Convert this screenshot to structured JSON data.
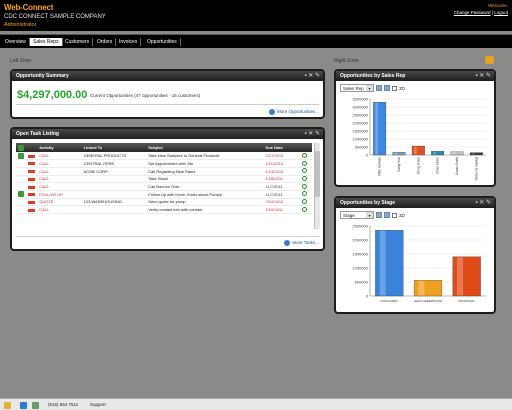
{
  "header": {
    "logo": "Web-Connect",
    "company": "CDC CONNECT SAMPLE COMPANY",
    "role": "Administrator",
    "welcome": "Welcome,",
    "change_password": "Change Password",
    "separator": "|",
    "logout": "Logout"
  },
  "nav": {
    "items": [
      "Overview",
      "Sales Reps",
      "Customers",
      "Orders",
      "Invoices",
      "Opportunities"
    ]
  },
  "left_zone_label": "Left Zone",
  "right_zone_label": "Right Zone",
  "opp_summary": {
    "title": "Opportunity Summary",
    "amount": "$4,297,000.00",
    "desc": "Current Opportunities (47 opportunities - 16 customers)",
    "more": "More Opportunities..."
  },
  "tasks": {
    "title": "Open Task Listing",
    "columns": [
      "Activity",
      "Linked To",
      "Subject",
      "Due Date"
    ],
    "rows": [
      {
        "flag": "done",
        "activity": "CALL",
        "linked": "GENERAL PRODUCTS",
        "subject": "Take New Samples to General Products",
        "due": "2/27/2013",
        "late": true
      },
      {
        "flag": "",
        "activity": "CALL",
        "linked": "CENTRAL PERK",
        "subject": "Set Appointment with Jim",
        "due": "1/11/2013",
        "late": true
      },
      {
        "flag": "",
        "activity": "CALL",
        "linked": "ACME CORP",
        "subject": "Call Regarding New Rates",
        "due": "1/13/2013",
        "late": true
      },
      {
        "flag": "",
        "activity": "CALL",
        "linked": "",
        "subject": "Take Stock",
        "due": "1/28/2011",
        "late": true
      },
      {
        "flag": "",
        "activity": "CALL",
        "linked": "",
        "subject": "Call Bounce Over",
        "due": "11/7/2011",
        "late": false
      },
      {
        "flag": "done",
        "activity": "FOLLOW UP",
        "linked": "",
        "subject": "Follow Up with Kevin Jones about Pumps",
        "due": "11/7/2011",
        "late": false
      },
      {
        "flag": "",
        "activity": "QUOTE",
        "linked": "123 WAREHOUSING",
        "subject": "Send quote for pump",
        "due": "7/19/2012",
        "late": true
      },
      {
        "flag": "",
        "activity": "CALL",
        "linked": "",
        "subject": "Verify contact info with contact",
        "due": "1/19/2011",
        "late": true
      }
    ],
    "more": "More Tasks..."
  },
  "sales_rep_panel": {
    "title": "Opportunities by Sales Rep",
    "select": "Sales Rep",
    "toggle_label": "3D"
  },
  "stage_panel": {
    "title": "Opportunities by Stage",
    "select": "Stage",
    "toggle_label": "3D"
  },
  "chart_data": [
    {
      "type": "bar",
      "title": "Opportunities by Sales Rep",
      "categories": [
        "Mike Hannah",
        "Kathy Kiwi",
        "Doug Jones",
        "Chad Stone",
        "Susan Smith",
        "Rebecca Hadley"
      ],
      "values": [
        3300000,
        180000,
        560000,
        230000,
        200000,
        150000
      ],
      "colors": [
        "#3e86e0",
        "#7ea0c0",
        "#e05020",
        "#2e86b0",
        "#c0c0c0",
        "#3a3a4a"
      ],
      "ylim": [
        0,
        3500000
      ],
      "yticks": [
        "3500000",
        "3000000",
        "2500000",
        "2000000",
        "1500000",
        "1000000",
        "500000",
        "0"
      ]
    },
    {
      "type": "bar",
      "title": "Opportunities by Stage",
      "categories": [
        "DISCOVERY",
        "LEAD GENERATION",
        "PROPOSAL"
      ],
      "values": [
        2350000,
        560000,
        1400000
      ],
      "colors": [
        "#3a82dc",
        "#f0a020",
        "#e04a18"
      ],
      "ylim": [
        0,
        2500000
      ],
      "yticks": [
        "2500000",
        "2000000",
        "1500000",
        "1000000",
        "500000",
        "0"
      ]
    }
  ],
  "footer": {
    "phone": "(615) 654 7511",
    "support": "Support"
  }
}
